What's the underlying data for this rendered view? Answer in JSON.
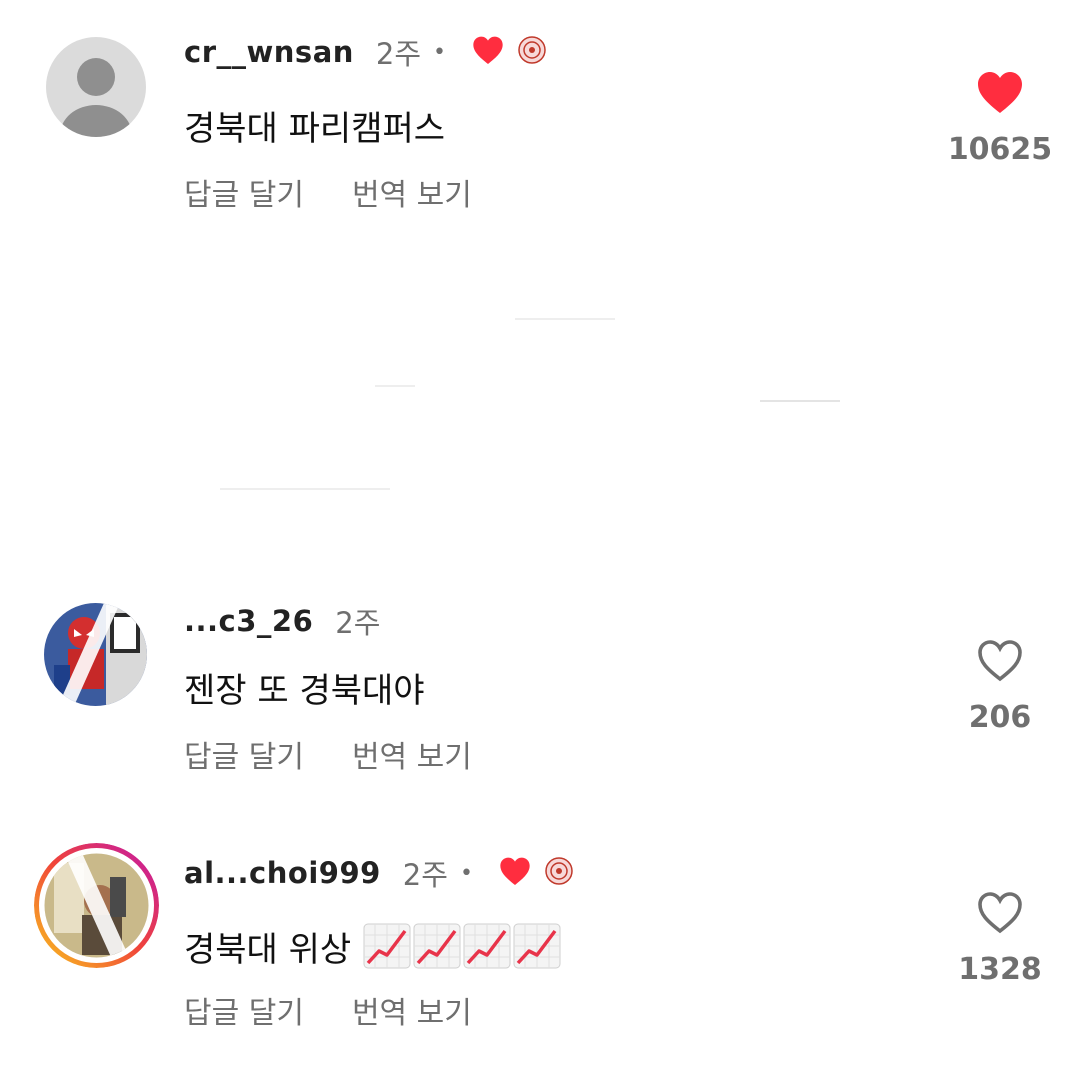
{
  "colors": {
    "like_red": "#ff2d3f",
    "secondary_text": "#6f6f6f",
    "primary_text": "#111111"
  },
  "comments": [
    {
      "username": "cr__wnsan",
      "time": "2주",
      "separator": "•",
      "creator_liked": true,
      "text": "경북대 파리캠퍼스",
      "actions": {
        "reply": "답글 달기",
        "translate": "번역 보기"
      },
      "liked": true,
      "like_count": "10625",
      "avatar_icon": "default-person-icon"
    },
    {
      "username": "...c3_26",
      "time": "2주",
      "creator_liked": false,
      "text": "젠장 또 경북대야",
      "actions": {
        "reply": "답글 달기",
        "translate": "번역 보기"
      },
      "liked": false,
      "like_count": "206",
      "avatar_icon": "spiderman-photo"
    },
    {
      "username": "al...choi999",
      "time": "2주",
      "separator": "•",
      "creator_liked": true,
      "text": "경북대 위상",
      "emoji": [
        "chart-increasing-emoji",
        "chart-increasing-emoji",
        "chart-increasing-emoji",
        "chart-increasing-emoji"
      ],
      "actions": {
        "reply": "답글 달기",
        "translate": "번역 보기"
      },
      "liked": false,
      "like_count": "1328",
      "avatar_icon": "story-ring-photo"
    }
  ]
}
